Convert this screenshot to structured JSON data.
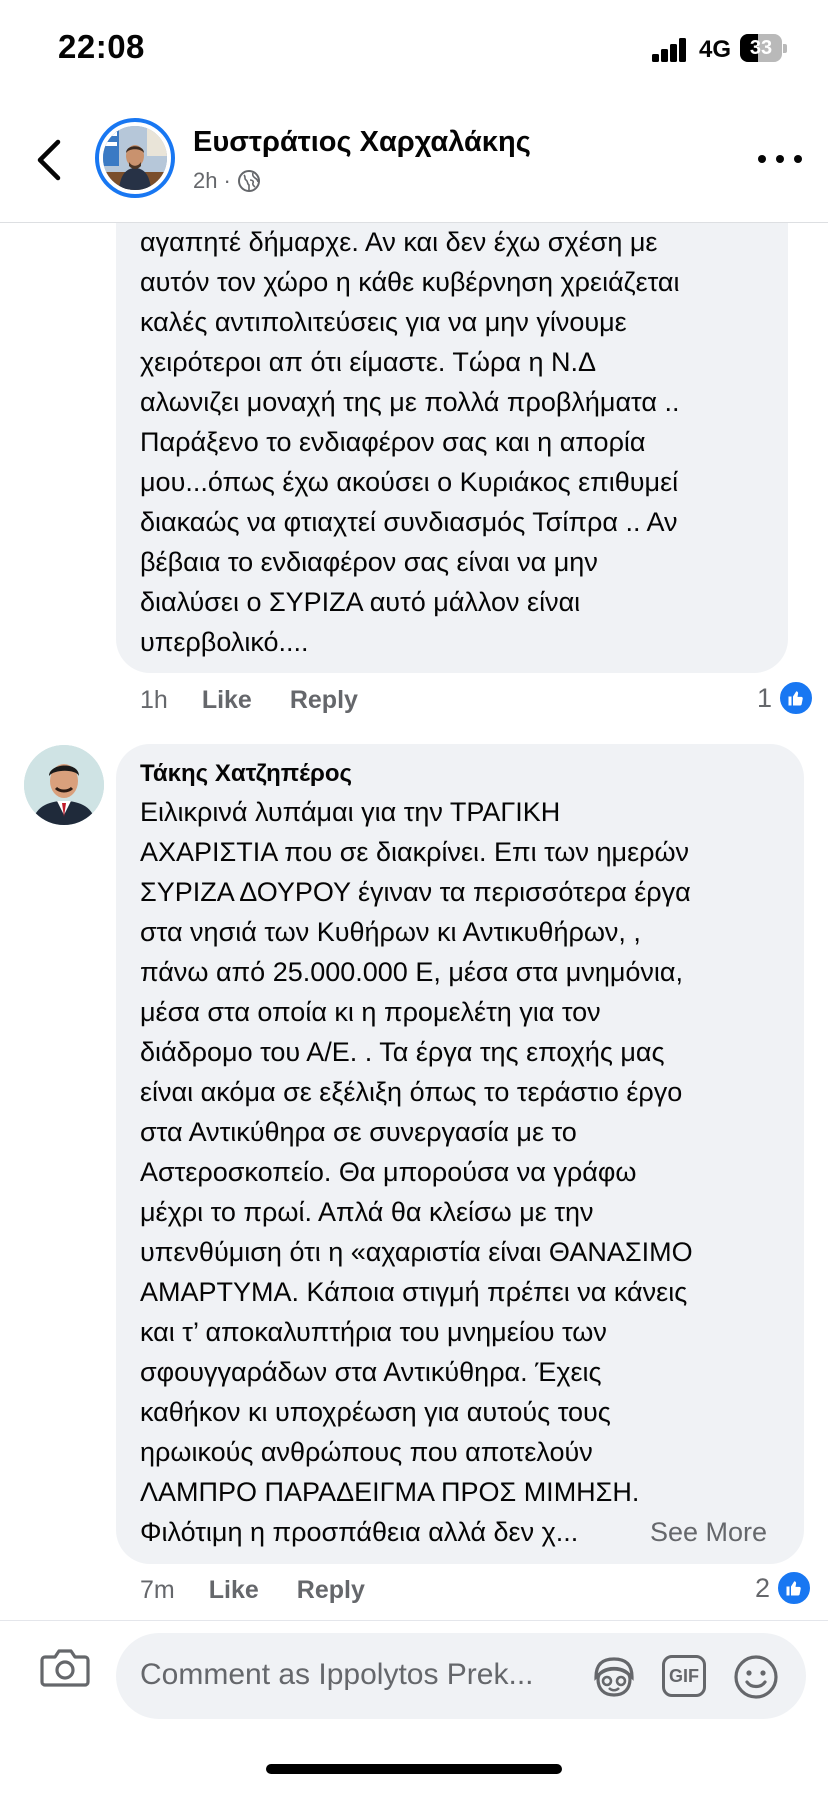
{
  "status_bar": {
    "time": "22:08",
    "network": "4G",
    "battery": "33"
  },
  "header": {
    "page_name": "Ευστράτιος Χαρχαλάκης",
    "post_age": "2h",
    "separator": "·",
    "audience_icon": "globe-icon"
  },
  "comments": [
    {
      "text": "αγαπητέ δήμαρχε. Αν και δεν έχω σχέση με\nαυτόν τον χώρο η κάθε κυβέρνηση χρειάζεται\nκαλές αντιπολιτεύσεις για να μην γίνουμε\nχειρότεροι απ ότι είμαστε. Τώρα η Ν.Δ\nαλωνιζει μοναχή της με πολλά προβλήματα ..\nΠαράξενο το ενδιαφέρον σας και η απορία\nμου...όπως έχω ακούσει ο Κυριάκος επιθυμεί\nδιακαώς να φτιαχτεί συνδιασμός Τσίπρα .. Αν\nβέβαια το ενδιαφέρον σας είναι να μην\nδιαλύσει ο ΣΥΡΙΖΑ αυτό μάλλον είναι\nυπερβολικό....",
      "time": "1h",
      "like_label": "Like",
      "reply_label": "Reply",
      "reactions": "1"
    },
    {
      "author": "Τάκης Χατζηπέρος",
      "text": "Ειλικρινά λυπάμαι για  την ΤΡΑΓΙΚΗ\nΑΧΑΡΙΣΤΙΑ που σε διακρίνει. Επι των ημερών\nΣΥΡΙΖΑ ΔΟΥΡΟΥ έγιναν τα περισσότερα έργα\nστα νησιά των Κυθήρων κι Αντικυθήρων, ,\nπάνω από 25.000.000 Ε, μέσα στα μνημόνια,\nμέσα στα οποία κι η προμελέτη για τον\nδιάδρομο του Α/Ε. . Τα έργα της εποχής μας\nείναι ακόμα σε εξέλιξη όπως το τεράστιο έργο\nστα Αντικύθηρα σε συνεργασία με το\nΑστεροσκοπείο. Θα μπορούσα να γράφω\nμέχρι το πρωί. Απλά θα κλείσω με την\nυπενθύμιση ότι η «αχαριστία είναι ΘΑΝΑΣΙΜΟ\nΑΜΑΡΤΥΜΑ.  Κάποια στιγμή πρέπει να κάνεις\nκαι τ’ αποκαλυπτήρια του μνημείου των\nσφουγγαράδων στα  Αντικύθηρα. Έχεις\nκαθήκον κι υποχρέωση για αυτούς τους\nηρωικούς ανθρώπους που αποτελούν\nΛΑΜΠΡΟ ΠΑΡΑΔΕΙΓΜΑ ΠΡΟΣ ΜΙΜΗΣΗ.\nΦιλότιμη η προσπάθεια αλλά δεν χ...",
      "see_more": "See More",
      "time": "7m",
      "like_label": "Like",
      "reply_label": "Reply",
      "reactions": "2"
    }
  ],
  "composer": {
    "placeholder": "Comment as Ippolytos Prek...",
    "gif_label": "GIF",
    "icons": [
      "camera-icon",
      "avatar-sticker-icon",
      "gif-icon",
      "emoji-icon"
    ]
  },
  "colors": {
    "accent": "#1877f2",
    "bubble": "#f0f2f5",
    "secondary_text": "#65676b"
  }
}
